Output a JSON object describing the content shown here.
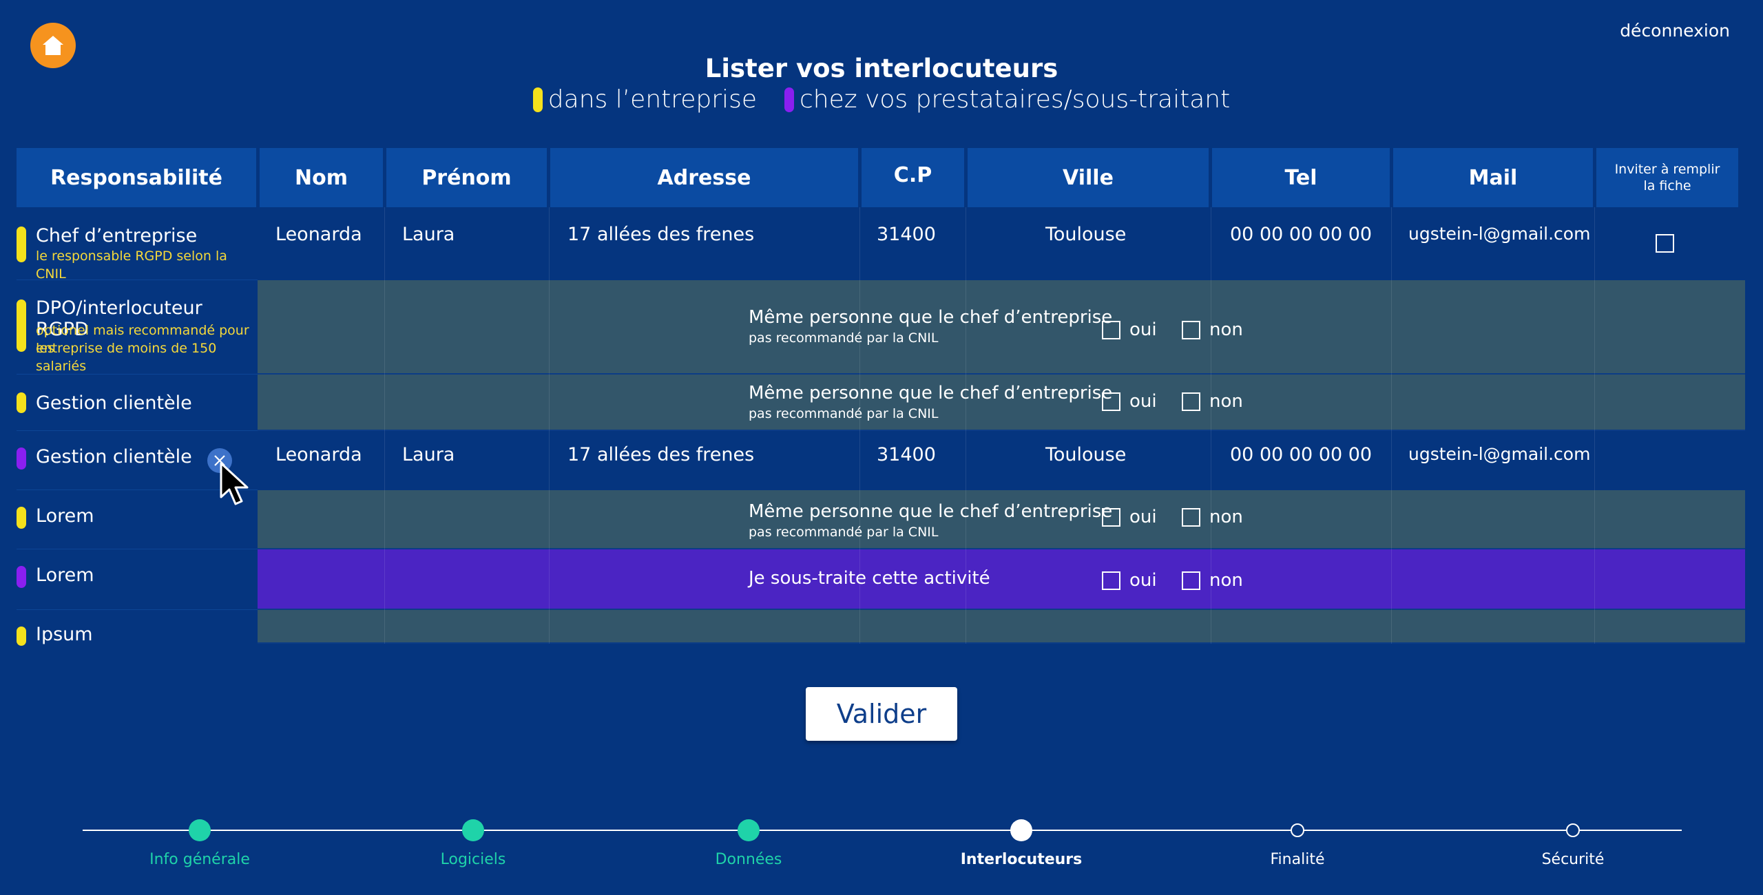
{
  "header": {
    "logout": "déconnexion",
    "title": "Lister vos interlocuteurs",
    "legend": [
      {
        "label": "dans l’entreprise",
        "color": "#f5e11c"
      },
      {
        "label": "chez vos prestataires/sous-traitant",
        "color": "#8a1ff0"
      }
    ]
  },
  "table": {
    "columns": [
      "Responsabilité",
      "Nom",
      "Prénom",
      "Adresse",
      "C.P",
      "Ville",
      "Tel",
      "Mail",
      "Inviter à remplir la fiche"
    ],
    "rows": [
      {
        "responsibility": "Chef d’entreprise",
        "note": "le responsable RGPD selon la CNIL",
        "nom": "Leonarda",
        "prenom": "Laura",
        "adresse": "17 allées des frenes",
        "cp": "31400",
        "ville": "Toulouse",
        "tel": "00 00 00 00 00",
        "mail": "ugstein-l@gmail.com"
      },
      {
        "responsibility": "DPO/interlocuteur RGPD",
        "note_line1": "optionel mais recommandé pour les",
        "note_line2": "entreprise de moins de 150 salariés",
        "question": "Même personne que le chef d’entreprise",
        "question_note": "pas recommandé par la CNIL"
      },
      {
        "responsibility": "Gestion clientèle",
        "question": "Même personne que le chef d’entreprise",
        "question_note": "pas recommandé par la CNIL"
      },
      {
        "responsibility": "Gestion clientèle",
        "nom": "Leonarda",
        "prenom": "Laura",
        "adresse": "17 allées des frenes",
        "cp": "31400",
        "ville": "Toulouse",
        "tel": "00 00 00 00 00",
        "mail": "ugstein-l@gmail.com"
      },
      {
        "responsibility": "Lorem",
        "question": "Même personne que le chef d’entreprise",
        "question_note": "pas recommandé par la CNIL"
      },
      {
        "responsibility": "Lorem",
        "question": "Je sous-traite cette activité"
      },
      {
        "responsibility": "Ipsum"
      }
    ],
    "yes": "oui",
    "no": "non"
  },
  "validate_label": "Valider",
  "steps": [
    {
      "label": "Info générale",
      "state": "done"
    },
    {
      "label": "Logiciels",
      "state": "done"
    },
    {
      "label": "Données",
      "state": "done"
    },
    {
      "label": "Interlocuteurs",
      "state": "current"
    },
    {
      "label": "Finalité",
      "state": "todo"
    },
    {
      "label": "Sécurité",
      "state": "todo"
    }
  ],
  "colors": {
    "background": "#05357f",
    "header_cell": "#0b4ba2",
    "internal": "#f5e11c",
    "provider": "#8a1ff0",
    "home": "#f6931e",
    "done": "#1fd3a9",
    "gray_row": "#33566a",
    "purple_row": "#4b24c3"
  }
}
